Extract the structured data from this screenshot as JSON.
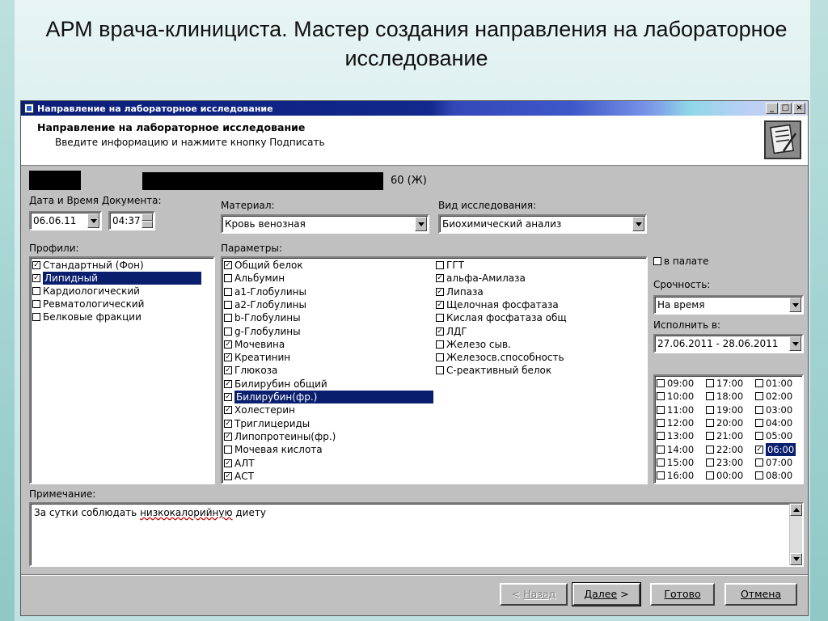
{
  "slide": {
    "title": "АРМ врача-клинициста. Мастер создания направления на лабораторное исследование"
  },
  "window": {
    "title": "Направление на лабораторное исследование",
    "header_title": "Направление на лабораторное исследование",
    "header_subtitle": "Введите информацию и нажмите кнопку Подписать"
  },
  "patient": {
    "age_sex": "60 (Ж)"
  },
  "doc": {
    "label": "Дата и Время Документа:",
    "date": "06.06.11",
    "time": "04:37"
  },
  "material": {
    "label": "Материал:",
    "value": "Кровь венозная"
  },
  "study": {
    "label": "Вид исследования:",
    "value": "Биохимический анализ"
  },
  "profiles": {
    "label": "Профили:",
    "items": [
      {
        "label": "Стандартный (Фон)",
        "checked": true,
        "selected": false
      },
      {
        "label": "Липидный",
        "checked": true,
        "selected": true
      },
      {
        "label": "Кардиологический",
        "checked": false,
        "selected": false
      },
      {
        "label": "Ревматологический",
        "checked": false,
        "selected": false
      },
      {
        "label": "Белковые фракции",
        "checked": false,
        "selected": false
      }
    ]
  },
  "params": {
    "label": "Параметры:",
    "col1": [
      {
        "label": "Общий белок",
        "checked": true
      },
      {
        "label": "Альбумин",
        "checked": false
      },
      {
        "label": "a1-Глобулины",
        "checked": false
      },
      {
        "label": "a2-Глобулины",
        "checked": false
      },
      {
        "label": "b-Глобулины",
        "checked": false
      },
      {
        "label": "g-Глобулины",
        "checked": false
      },
      {
        "label": "Мочевина",
        "checked": true
      },
      {
        "label": "Креатинин",
        "checked": true
      },
      {
        "label": "Глюкоза",
        "checked": true
      },
      {
        "label": "Билирубин общий",
        "checked": true
      },
      {
        "label": "Билирубин(фр.)",
        "checked": true,
        "selected": true
      },
      {
        "label": "Холестерин",
        "checked": true
      },
      {
        "label": "Триглицериды",
        "checked": true
      },
      {
        "label": "Липопротеины(фр.)",
        "checked": true
      },
      {
        "label": "Мочевая кислота",
        "checked": false
      },
      {
        "label": "АЛТ",
        "checked": true
      },
      {
        "label": "АСТ",
        "checked": true
      }
    ],
    "col2": [
      {
        "label": "ГГТ",
        "checked": false
      },
      {
        "label": "альфа-Амилаза",
        "checked": true
      },
      {
        "label": "Липаза",
        "checked": true
      },
      {
        "label": "Щелочная фосфатаза",
        "checked": true
      },
      {
        "label": "Кислая фосфатаза общ",
        "checked": false
      },
      {
        "label": "ЛДГ",
        "checked": true
      },
      {
        "label": "Железо сыв.",
        "checked": false
      },
      {
        "label": "Железосв.способность",
        "checked": false
      },
      {
        "label": "С-реактивный белок",
        "checked": false
      }
    ]
  },
  "ward": {
    "label": "в палате",
    "checked": false
  },
  "urgency": {
    "label": "Срочность:",
    "value": "На время"
  },
  "execute": {
    "label": "Исполнить в:",
    "value": "27.06.2011 - 28.06.2011"
  },
  "times": {
    "col1": [
      "09:00",
      "10:00",
      "11:00",
      "12:00",
      "13:00",
      "14:00",
      "15:00",
      "16:00"
    ],
    "col2": [
      "17:00",
      "18:00",
      "19:00",
      "20:00",
      "21:00",
      "22:00",
      "23:00",
      "00:00"
    ],
    "col3": [
      "01:00",
      "02:00",
      "03:00",
      "04:00",
      "05:00",
      "06:00",
      "07:00",
      "08:00"
    ],
    "checked": "06:00"
  },
  "note": {
    "label": "Примечание:",
    "text_before": "За сутки соблюдать ",
    "text_wavy": "низкокалорийную",
    "text_after": " диету"
  },
  "buttons": {
    "back": "Назад",
    "next": "Далее",
    "done": "Готово",
    "cancel": "Отмена"
  }
}
